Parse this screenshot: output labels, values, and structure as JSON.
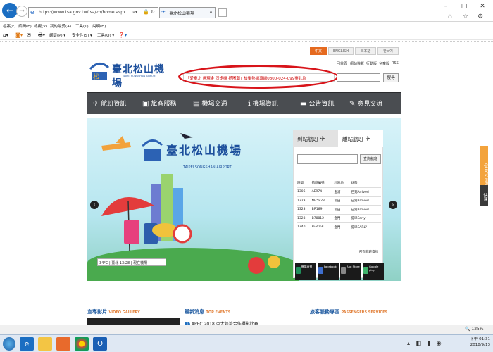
{
  "browser": {
    "url": "https://www.tsa.gov.tw/tsa/zh/home.aspx",
    "tab_title": "臺北松山機場",
    "menu": [
      "檔案(F)",
      "編輯(E)",
      "檢視(V)",
      "我的最愛(A)",
      "工具(T)",
      "說明(H)"
    ],
    "commands": [
      "網頁(P) ▾",
      "安全性(S) ▾",
      "工具(O) ▾"
    ],
    "zoom": "125%"
  },
  "site": {
    "languages": [
      "中文",
      "ENGLISH",
      "日本語",
      "한국어"
    ],
    "logo_zh": "臺北松山機場",
    "logo_en": "TAIPEI SONGSHAN AIRPORT",
    "top_links": [
      "回首頁",
      "網站導覽",
      "行動版",
      "兒童版",
      "RSS"
    ],
    "marquee": "「愛臺北 無現金 同步機 抒困潮」檢舉熱線專線0800-024-099臺北垃",
    "search_button": "搜尋",
    "nav": [
      {
        "label": "航班資訊",
        "icon": "plane-icon"
      },
      {
        "label": "旅客服務",
        "icon": "luggage-icon"
      },
      {
        "label": "機場交通",
        "icon": "bus-icon"
      },
      {
        "label": "機場資訊",
        "icon": "info-icon"
      },
      {
        "label": "公告資訊",
        "icon": "folder-icon"
      },
      {
        "label": "意見交流",
        "icon": "pencil-icon"
      }
    ],
    "banner": {
      "title_zh": "臺北松山機場",
      "title_en": "TAIPEI SONGSHAN AIRPORT",
      "weather": "34°C | 臺北 13:28 | 現在機場"
    },
    "flights": {
      "arrival_tab": "到站航班",
      "departure_tab": "離站航班",
      "query_button": "查詢航班",
      "headers": [
        "時間",
        "航班編號",
        "起降地",
        "狀態"
      ],
      "rows": [
        [
          "1306",
          "AE974",
          "金浦",
          "已到Arrived"
        ],
        [
          "1323",
          "NH5823",
          "羽田",
          "已到Arrived"
        ],
        [
          "1323",
          "BR189",
          "羽田",
          "已到Arrived"
        ],
        [
          "1328",
          "B78812",
          "金門",
          "提早Early"
        ],
        [
          "1340",
          "FE8068",
          "金門",
          "提早EARLY"
        ]
      ],
      "all_flights": "所有航班資訊"
    },
    "apps": [
      "機場直播",
      "Facebook",
      "App Store",
      "Google play"
    ],
    "sections": [
      {
        "zh": "宣導影片",
        "en": "VIDEO GALLERY"
      },
      {
        "zh": "最新消息",
        "en": "TOP EVENTS"
      },
      {
        "zh": "旅客服務專區",
        "en": "PASSENGERS SERVICES"
      }
    ],
    "news_item": "APEC 2018 亞太經濟合作攝影比賽",
    "quick_menu": "QUICK MENU",
    "quick_link": "快速"
  },
  "taskbar": {
    "time": "下午 01:31",
    "date": "2018/9/13"
  }
}
